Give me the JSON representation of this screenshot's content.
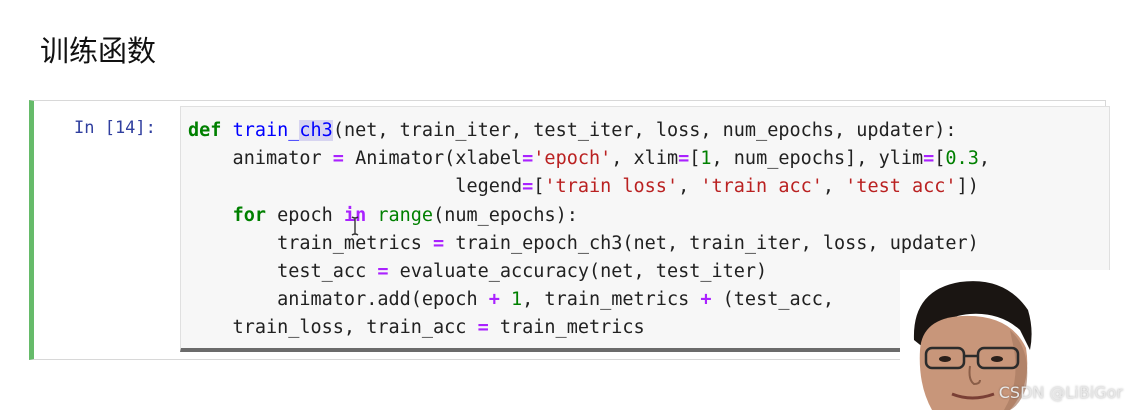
{
  "heading": "训练函数",
  "cell": {
    "prompt": "In [14]:",
    "lines": [
      [
        {
          "t": "def",
          "c": "kw"
        },
        {
          "t": " ",
          "c": ""
        },
        {
          "t": "train_",
          "c": "fn"
        },
        {
          "t": "ch3",
          "c": "fn sel"
        },
        {
          "t": "(net, train_iter, test_iter, loss, num_epochs, updater):",
          "c": ""
        }
      ],
      [
        {
          "t": "    animator ",
          "c": ""
        },
        {
          "t": "=",
          "c": "op"
        },
        {
          "t": " Animator(xlabel",
          "c": ""
        },
        {
          "t": "=",
          "c": "op"
        },
        {
          "t": "'epoch'",
          "c": "str"
        },
        {
          "t": ", xlim",
          "c": ""
        },
        {
          "t": "=",
          "c": "op"
        },
        {
          "t": "[",
          "c": ""
        },
        {
          "t": "1",
          "c": "num"
        },
        {
          "t": ", num_epochs], ylim",
          "c": ""
        },
        {
          "t": "=",
          "c": "op"
        },
        {
          "t": "[",
          "c": ""
        },
        {
          "t": "0.3",
          "c": "num"
        },
        {
          "t": ",",
          "c": ""
        }
      ],
      [
        {
          "t": "                        legend",
          "c": ""
        },
        {
          "t": "=",
          "c": "op"
        },
        {
          "t": "[",
          "c": ""
        },
        {
          "t": "'train loss'",
          "c": "str"
        },
        {
          "t": ", ",
          "c": ""
        },
        {
          "t": "'train acc'",
          "c": "str"
        },
        {
          "t": ", ",
          "c": ""
        },
        {
          "t": "'test acc'",
          "c": "str"
        },
        {
          "t": "])",
          "c": ""
        }
      ],
      [
        {
          "t": "    ",
          "c": ""
        },
        {
          "t": "for",
          "c": "kw"
        },
        {
          "t": " epoch ",
          "c": ""
        },
        {
          "t": "in",
          "c": "op"
        },
        {
          "t": " ",
          "c": ""
        },
        {
          "t": "range",
          "c": "bi"
        },
        {
          "t": "(num_epochs):",
          "c": ""
        }
      ],
      [
        {
          "t": "        train_metrics ",
          "c": ""
        },
        {
          "t": "=",
          "c": "op"
        },
        {
          "t": " train_epoch_ch3(net, train_iter, loss, updater)",
          "c": ""
        }
      ],
      [
        {
          "t": "        test_acc ",
          "c": ""
        },
        {
          "t": "=",
          "c": "op"
        },
        {
          "t": " evaluate_accuracy(net, test_iter)",
          "c": ""
        }
      ],
      [
        {
          "t": "        animator.add(epoch ",
          "c": ""
        },
        {
          "t": "+",
          "c": "op"
        },
        {
          "t": " ",
          "c": ""
        },
        {
          "t": "1",
          "c": "num"
        },
        {
          "t": ", train_metrics ",
          "c": ""
        },
        {
          "t": "+",
          "c": "op"
        },
        {
          "t": " (test_acc,",
          "c": ""
        }
      ],
      [
        {
          "t": "    train_loss, train_acc ",
          "c": ""
        },
        {
          "t": "=",
          "c": "op"
        },
        {
          "t": " train_metrics",
          "c": ""
        }
      ]
    ]
  },
  "watermark": "CSDN @LiBiGor",
  "colors": {
    "cell_border_active": "#66bb6a",
    "prompt": "#303f9f",
    "keyword": "#008000",
    "function_name": "#0000ff",
    "operator": "#aa22ff",
    "string": "#ba2121",
    "selection": "#d7d4f0"
  },
  "icons": {
    "cursor": "text-cursor-icon"
  }
}
